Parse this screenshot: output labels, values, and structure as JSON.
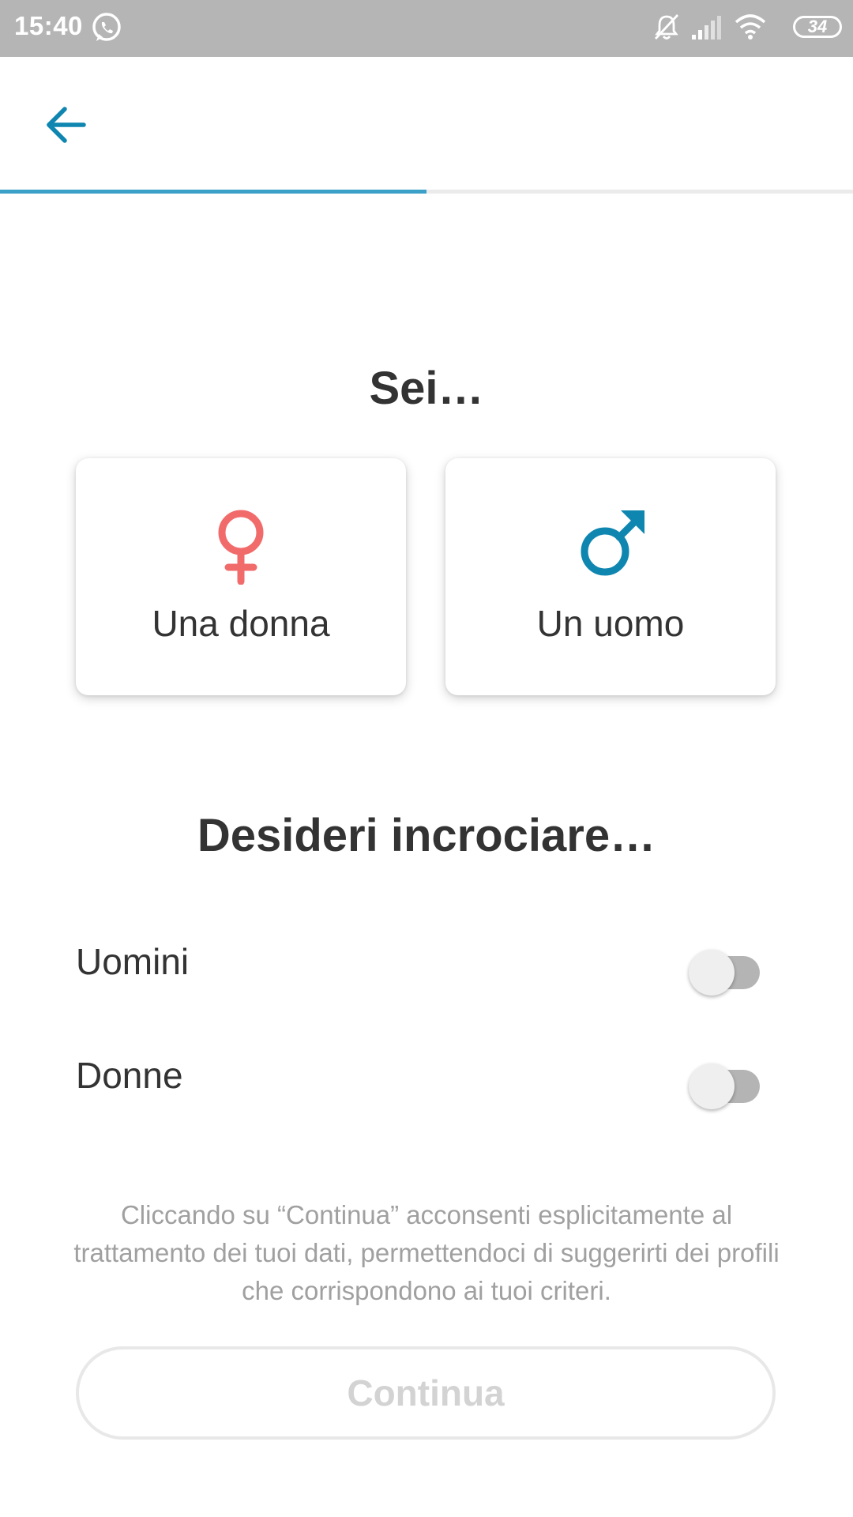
{
  "status_bar": {
    "time": "15:40",
    "battery": "34",
    "icons": [
      "whatsapp-icon",
      "bell-muted-icon",
      "signal-icon",
      "wifi-icon",
      "battery-icon"
    ]
  },
  "app_bar": {
    "back_icon": "arrow-left-icon"
  },
  "progress": {
    "fraction": 0.5,
    "color": "#3aa0c8",
    "track_color": "#ebebeb"
  },
  "gender_section": {
    "title": "Sei…",
    "options": [
      {
        "label": "Una donna",
        "icon": "female-symbol-icon",
        "color": "#f26b6b"
      },
      {
        "label": "Un uomo",
        "icon": "male-symbol-icon",
        "color": "#0f86b0"
      }
    ]
  },
  "preference_section": {
    "title": "Desideri incrociare…",
    "toggles": [
      {
        "label": "Uomini",
        "on": false
      },
      {
        "label": "Donne",
        "on": false
      }
    ]
  },
  "consent_text": "Cliccando su “Continua” acconsenti esplicitamente al trattamento dei tuoi dati, permettendoci di suggerirti dei profili che corrispondono ai tuoi criteri.",
  "continue_button": {
    "label": "Continua",
    "enabled": false
  }
}
